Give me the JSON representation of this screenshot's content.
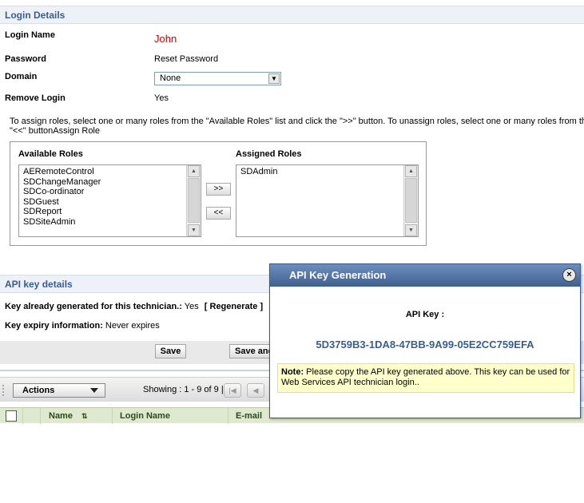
{
  "login": {
    "header": "Login Details",
    "login_name_label": "Login Name",
    "login_name_value": "John",
    "password_label": "Password",
    "password_value": "Reset Password",
    "domain_label": "Domain",
    "domain_value": "None",
    "remove_login_label": "Remove Login",
    "remove_login_value": "Yes"
  },
  "roles": {
    "instruction_line1": "To assign roles, select one or many roles from the \"Available Roles\" list and click the \">>\" button. To unassign roles, select one or many roles from the \"As",
    "instruction_line2": "\"<<\" buttonAssign Role",
    "available_label": "Available Roles",
    "assigned_label": "Assigned Roles",
    "available": [
      "AERemoteControl",
      "SDChangeManager",
      "SDCo-ordinator",
      "SDGuest",
      "SDReport",
      "SDSiteAdmin"
    ],
    "assigned": [
      "SDAdmin"
    ],
    "add_button": ">>",
    "remove_button": "<<"
  },
  "api": {
    "header": "API key details",
    "key_generated_label": "Key already generated for this technician.:",
    "key_generated_value": "Yes",
    "regenerate_link": "[ Regenerate ]",
    "expiry_label": "Key expiry information:",
    "expiry_value": "Never expires"
  },
  "buttons": {
    "save": "Save",
    "save_and": "Save and"
  },
  "toolbar": {
    "actions_label": "Actions",
    "showing": "Showing : 1 - 9 of 9 |"
  },
  "table": {
    "columns": [
      "Name",
      "Login Name",
      "E-mail"
    ]
  },
  "dialog": {
    "title": "API Key Generation",
    "close_glyph": "×",
    "api_key_label": "API Key :",
    "api_key_value": "5D3759B3-1DA8-47BB-9A99-05E2CC759EFA",
    "note_label": "Note:",
    "note_text": "Please copy the API key generated above. This key can be used for Web Services API technician login.."
  },
  "colors": {
    "section_header_text": "#3a5d8f",
    "login_name_value": "#cc0000",
    "api_key_value": "#3a5d8f",
    "dialog_title_bg": "#3f5f90",
    "note_bg": "#ffffcc"
  }
}
